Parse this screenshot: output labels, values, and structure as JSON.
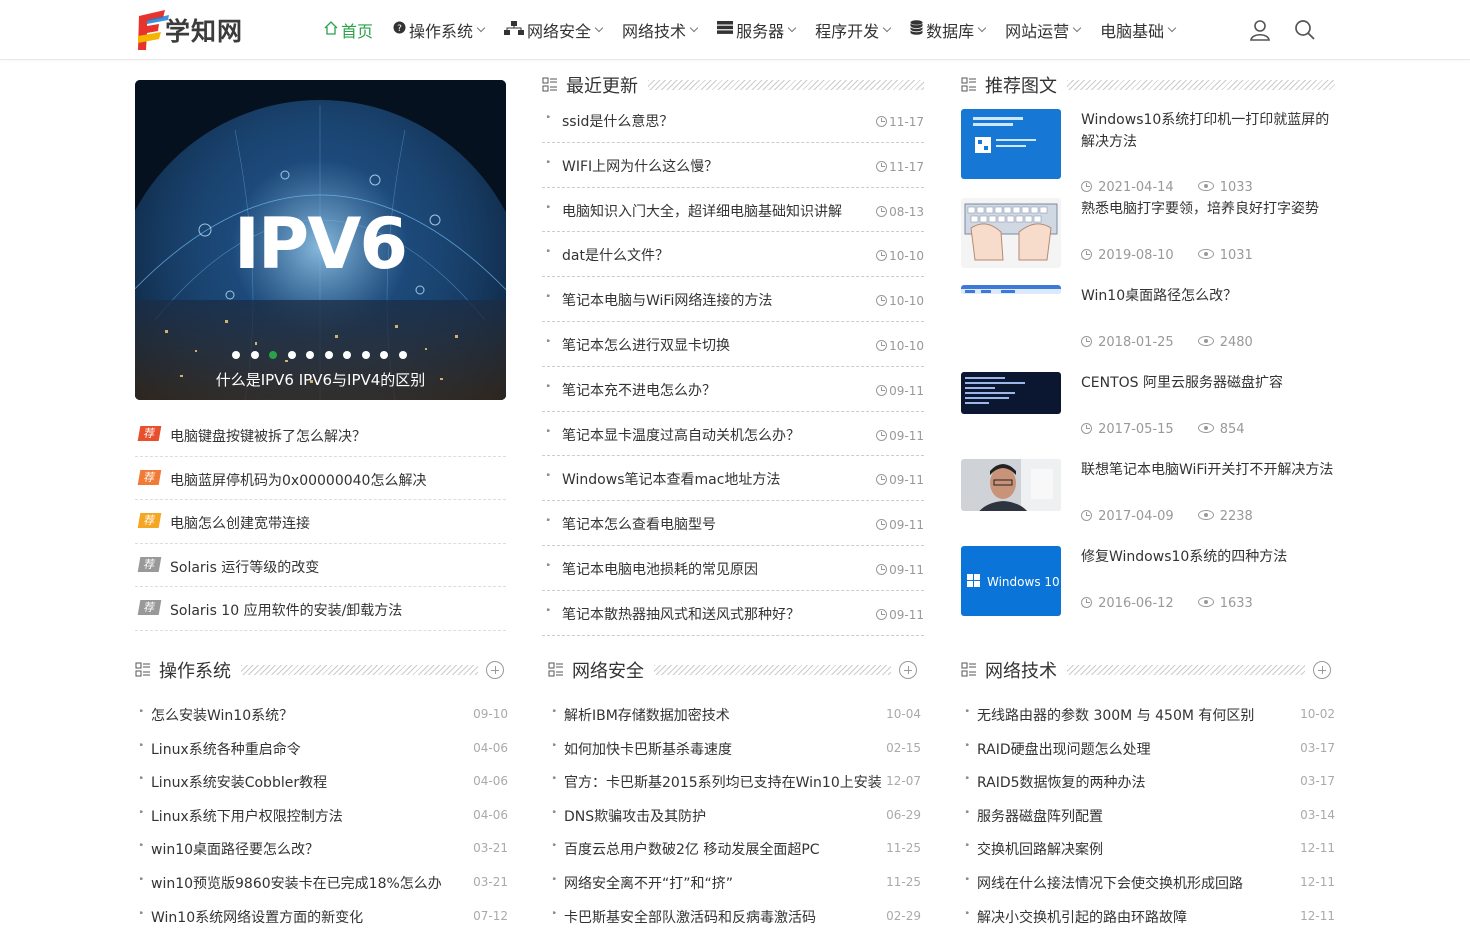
{
  "site": {
    "logo_text": "学知网"
  },
  "nav": [
    {
      "label": "首页",
      "icon": "home-icon",
      "active": true,
      "dropdown": false
    },
    {
      "label": "操作系统",
      "icon": "question-icon",
      "dropdown": true
    },
    {
      "label": "网络安全",
      "icon": "network-icon",
      "dropdown": true
    },
    {
      "label": "网络技术",
      "icon": "",
      "dropdown": true
    },
    {
      "label": "服务器",
      "icon": "server-icon",
      "dropdown": true
    },
    {
      "label": "程序开发",
      "icon": "",
      "dropdown": true
    },
    {
      "label": "数据库",
      "icon": "database-icon",
      "dropdown": true
    },
    {
      "label": "网站运营",
      "icon": "",
      "dropdown": true
    },
    {
      "label": "电脑基础",
      "icon": "",
      "dropdown": true
    }
  ],
  "slider": {
    "banner_text": "IPV6",
    "caption": "什么是IPV6 IPV6与IPV4的区别",
    "dot_count": 10,
    "active_dot": 2
  },
  "recommend_badge": "荐",
  "recommend": [
    {
      "title": "电脑键盘按键被拆了怎么解决？",
      "color": "#e8502d"
    },
    {
      "title": "电脑蓝屏停机码为0x00000040怎么解决",
      "color": "#f07a36"
    },
    {
      "title": "电脑怎么创建宽带连接",
      "color": "#f5a623"
    },
    {
      "title": "Solaris 运行等级的改变",
      "color": "#999999"
    },
    {
      "title": "Solaris 10 应用软件的安装/卸载方法",
      "color": "#999999"
    }
  ],
  "latest": {
    "heading": "最近更新",
    "items": [
      {
        "title": "ssid是什么意思？",
        "date": "11-17"
      },
      {
        "title": "WIFI上网为什么这么慢？",
        "date": "11-17"
      },
      {
        "title": "电脑知识入门大全，超详细电脑基础知识讲解",
        "date": "08-13"
      },
      {
        "title": "dat是什么文件？",
        "date": "10-10"
      },
      {
        "title": "笔记本电脑与WiFi网络连接的方法",
        "date": "10-10"
      },
      {
        "title": "笔记本怎么进行双显卡切换",
        "date": "10-10"
      },
      {
        "title": "笔记本充不进电怎么办？",
        "date": "09-11"
      },
      {
        "title": "笔记本显卡温度过高自动关机怎么办？",
        "date": "09-11"
      },
      {
        "title": "Windows笔记本查看mac地址方法",
        "date": "09-11"
      },
      {
        "title": "笔记本怎么查看电脑型号",
        "date": "09-11"
      },
      {
        "title": "笔记本电脑电池损耗的常见原因",
        "date": "09-11"
      },
      {
        "title": "笔记本散热器抽风式和送风式那种好？",
        "date": "09-11"
      }
    ]
  },
  "featured": {
    "heading": "推荐图文",
    "items": [
      {
        "title": "Windows10系统打印机一打印就蓝屏的解决方法",
        "date": "2021-04-14",
        "views": "1033",
        "thumb": "bsod"
      },
      {
        "title": "熟悉电脑打字要领，培养良好打字姿势",
        "date": "2019-08-10",
        "views": "1031",
        "thumb": "keyboard"
      },
      {
        "title": "Win10桌面路径怎么改？",
        "date": "2018-01-25",
        "views": "2480",
        "thumb": "desktop"
      },
      {
        "title": "CENTOS 阿里云服务器磁盘扩容",
        "date": "2017-05-15",
        "views": "854",
        "thumb": "terminal"
      },
      {
        "title": "联想笔记本电脑WiFi开关打不开解决方法",
        "date": "2017-04-09",
        "views": "2238",
        "thumb": "person"
      },
      {
        "title": "修复Windows10系统的四种方法",
        "date": "2016-06-12",
        "views": "1633",
        "thumb": "win10"
      }
    ],
    "win10_label": "Windows 10"
  },
  "columns": [
    {
      "heading": "操作系统",
      "items": [
        {
          "title": "怎么安装Win10系统？",
          "date": "09-10"
        },
        {
          "title": "Linux系统各种重启命令",
          "date": "04-06"
        },
        {
          "title": "Linux系统安装Cobbler教程",
          "date": "04-06"
        },
        {
          "title": "Linux系统下用户权限控制方法",
          "date": "04-06"
        },
        {
          "title": "win10桌面路径要怎么改？",
          "date": "03-21"
        },
        {
          "title": "win10预览版9860安装卡在已完成18%怎么办",
          "date": "03-21"
        },
        {
          "title": "Win10系统网络设置方面的新变化",
          "date": "07-12"
        }
      ]
    },
    {
      "heading": "网络安全",
      "items": [
        {
          "title": "解析IBM存储数据加密技术",
          "date": "10-04"
        },
        {
          "title": "如何加快卡巴斯基杀毒速度",
          "date": "02-15"
        },
        {
          "title": "官方：卡巴斯基2015系列均已支持在Win10上安装",
          "date": "12-07"
        },
        {
          "title": "DNS欺骗攻击及其防护",
          "date": "06-29"
        },
        {
          "title": "百度云总用户数破2亿 移动发展全面超PC",
          "date": "11-25"
        },
        {
          "title": "网络安全离不开“打”和“挤”",
          "date": "11-25"
        },
        {
          "title": "卡巴斯基安全部队激活码和反病毒激活码",
          "date": "02-29"
        }
      ]
    },
    {
      "heading": "网络技术",
      "items": [
        {
          "title": "无线路由器的参数 300M 与 450M 有何区别",
          "date": "10-02"
        },
        {
          "title": "RAID硬盘出现问题怎么处理",
          "date": "03-17"
        },
        {
          "title": "RAID5数据恢复的两种办法",
          "date": "03-17"
        },
        {
          "title": "服务器磁盘阵列配置",
          "date": "03-14"
        },
        {
          "title": "交换机回路解决案例",
          "date": "12-11"
        },
        {
          "title": "网线在什么接法情况下会使交换机形成回路",
          "date": "12-11"
        },
        {
          "title": "解决小交换机引起的路由环路故障",
          "date": "12-11"
        }
      ]
    }
  ],
  "colors": {
    "accent": "#2aa24a",
    "text": "#333333",
    "muted": "#999999"
  }
}
